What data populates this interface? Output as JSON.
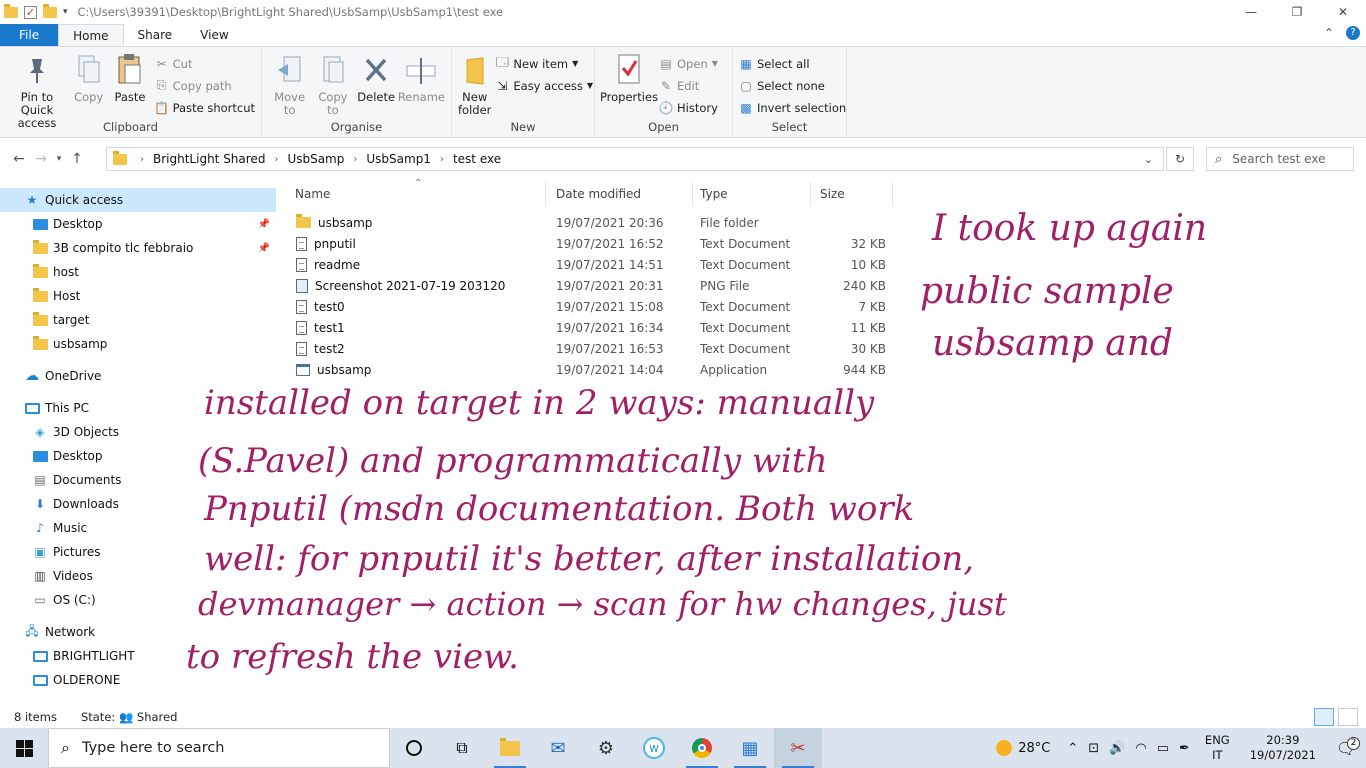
{
  "window": {
    "title_path": "C:\\Users\\39391\\Desktop\\BrightLight Shared\\UsbSamp\\UsbSamp1\\test exe"
  },
  "ribbon": {
    "tabs": [
      "File",
      "Home",
      "Share",
      "View"
    ],
    "clipboard": {
      "label": "Clipboard",
      "pin": "Pin to Quick access",
      "copy": "Copy",
      "paste": "Paste",
      "cut": "Cut",
      "copy_path": "Copy path",
      "paste_shortcut": "Paste shortcut"
    },
    "organise": {
      "label": "Organise",
      "move_to": "Move to",
      "copy_to": "Copy to",
      "delete": "Delete",
      "rename": "Rename"
    },
    "new": {
      "label": "New",
      "new_folder": "New folder",
      "new_item": "New item",
      "easy_access": "Easy access"
    },
    "open": {
      "label": "Open",
      "properties": "Properties",
      "open": "Open",
      "edit": "Edit",
      "history": "History"
    },
    "select": {
      "label": "Select",
      "select_all": "Select all",
      "select_none": "Select none",
      "invert": "Invert selection"
    }
  },
  "address": {
    "crumbs": [
      "BrightLight Shared",
      "UsbSamp",
      "UsbSamp1",
      "test exe"
    ],
    "search_placeholder": "Search test exe"
  },
  "nav": {
    "quick_access": "Quick access",
    "quick_items": [
      "Desktop",
      "3B compito tlc febbraio",
      "host",
      "Host",
      "target",
      "usbsamp"
    ],
    "onedrive": "OneDrive",
    "this_pc": "This PC",
    "pc_items": [
      "3D Objects",
      "Desktop",
      "Documents",
      "Downloads",
      "Music",
      "Pictures",
      "Videos",
      "OS (C:)"
    ],
    "network": "Network",
    "network_items": [
      "BRIGHTLIGHT",
      "OLDERONE"
    ]
  },
  "files": {
    "columns": [
      "Name",
      "Date modified",
      "Type",
      "Size"
    ],
    "rows": [
      {
        "name": "usbsamp",
        "date": "19/07/2021 20:36",
        "type": "File folder",
        "size": "",
        "icon": "folder"
      },
      {
        "name": "pnputil",
        "date": "19/07/2021 16:52",
        "type": "Text Document",
        "size": "32 KB",
        "icon": "doc"
      },
      {
        "name": "readme",
        "date": "19/07/2021 14:51",
        "type": "Text Document",
        "size": "10 KB",
        "icon": "doc"
      },
      {
        "name": "Screenshot 2021-07-19 203120",
        "date": "19/07/2021 20:31",
        "type": "PNG File",
        "size": "240 KB",
        "icon": "image"
      },
      {
        "name": "test0",
        "date": "19/07/2021 15:08",
        "type": "Text Document",
        "size": "7 KB",
        "icon": "doc"
      },
      {
        "name": "test1",
        "date": "19/07/2021 16:34",
        "type": "Text Document",
        "size": "11 KB",
        "icon": "doc"
      },
      {
        "name": "test2",
        "date": "19/07/2021 16:53",
        "type": "Text Document",
        "size": "30 KB",
        "icon": "doc"
      },
      {
        "name": "usbsamp",
        "date": "19/07/2021 14:04",
        "type": "Application",
        "size": "944 KB",
        "icon": "app"
      }
    ]
  },
  "status": {
    "count": "8 items",
    "state_label": "State:",
    "state_value": "Shared"
  },
  "taskbar": {
    "search_placeholder": "Type here to search",
    "temperature": "28°C",
    "lang_top": "ENG",
    "lang_bottom": "IT",
    "time": "20:39",
    "date": "19/07/2021",
    "notifications": "2"
  },
  "ink": {
    "lines": [
      "I took up again",
      "public sample",
      "usbsamp and",
      "installed on target in 2 ways: manually",
      "(S.Pavel) and programmatically with",
      "Pnputil (msdn documentation. Both work",
      "well: for pnputil it's better, after installation,",
      "devmanager → action → scan for hw changes, just",
      "to refresh the view."
    ]
  },
  "colors": {
    "accent": "#1979ca",
    "selection": "#cce8ff",
    "ink": "#a01f66"
  }
}
